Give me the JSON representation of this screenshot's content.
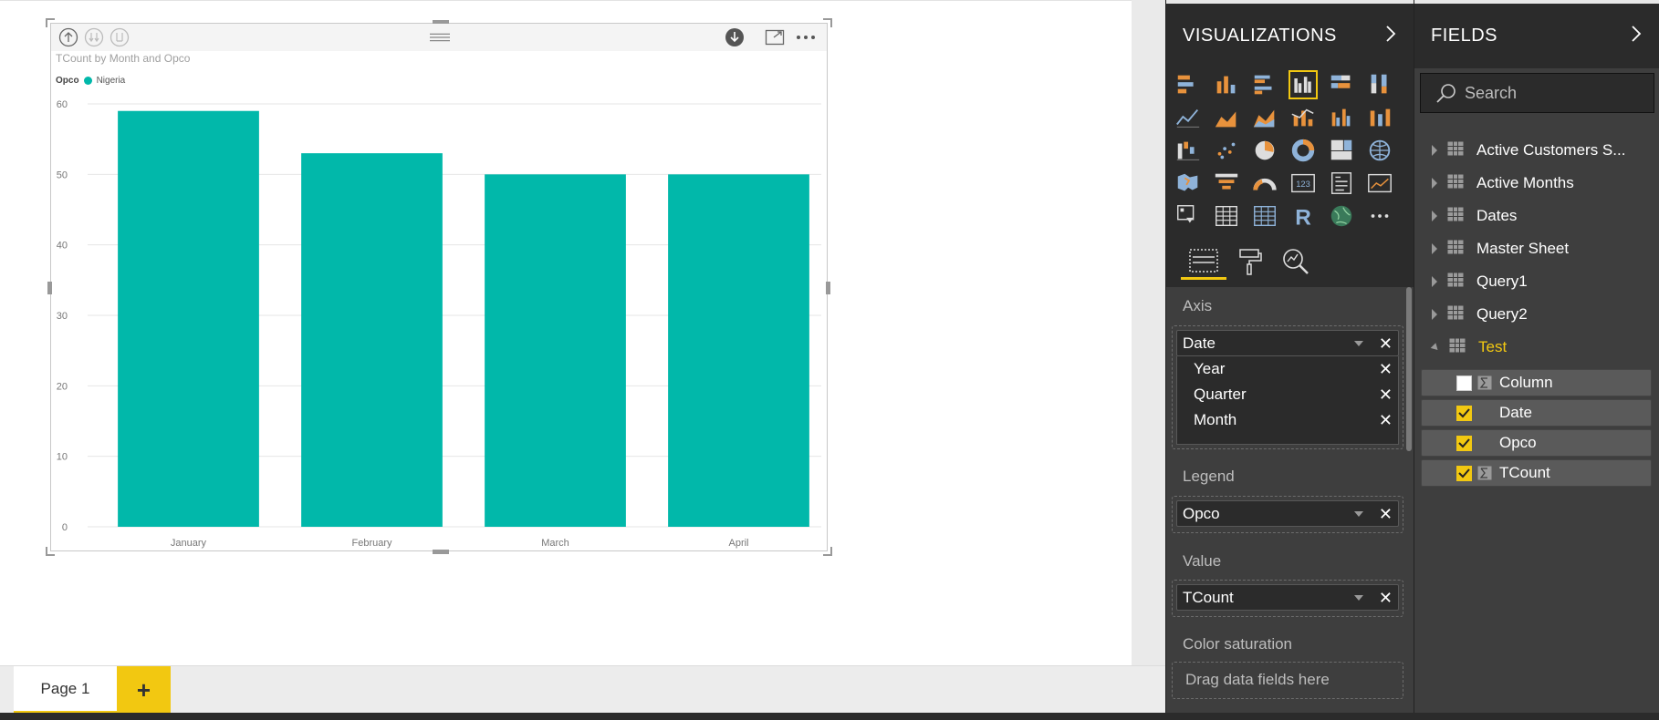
{
  "report": {
    "page_tab": "Page 1",
    "add_page": "+"
  },
  "visual": {
    "title": "TCount by Month and Opco",
    "legend_title": "Opco",
    "legend_item": "Nigeria"
  },
  "chart_data": {
    "type": "bar",
    "title": "TCount by Month and Opco",
    "categories": [
      "January",
      "February",
      "March",
      "April"
    ],
    "series": [
      {
        "name": "Nigeria",
        "values": [
          59,
          53,
          50,
          50
        ],
        "color": "#01b8aa"
      }
    ],
    "yticks": [
      "0",
      "10",
      "20",
      "30",
      "40",
      "50",
      "60"
    ],
    "ylim": [
      0,
      60
    ],
    "grid": true,
    "legend": "top-left"
  },
  "visualizations": {
    "title": "VISUALIZATIONS",
    "wells": {
      "axis": {
        "label": "Axis",
        "field": "Date",
        "children": [
          "Year",
          "Quarter",
          "Month"
        ]
      },
      "legend": {
        "label": "Legend",
        "field": "Opco"
      },
      "value": {
        "label": "Value",
        "field": "TCount"
      },
      "color_saturation": {
        "label": "Color saturation",
        "hint": "Drag data fields here"
      }
    }
  },
  "fields": {
    "title": "FIELDS",
    "search_placeholder": "Search",
    "tables": [
      "Active Customers S...",
      "Active Months",
      "Dates",
      "Master Sheet",
      "Query1",
      "Query2",
      "Test"
    ],
    "test_fields": [
      {
        "name": "Column",
        "checked": false
      },
      {
        "name": "Date",
        "checked": true
      },
      {
        "name": "Opco",
        "checked": true
      },
      {
        "name": "TCount",
        "checked": true
      }
    ]
  },
  "colors": {
    "accent": "#f2c811",
    "bar": "#01b8aa",
    "pane_dark": "#2b2b2b",
    "pane": "#3e3e3e"
  }
}
